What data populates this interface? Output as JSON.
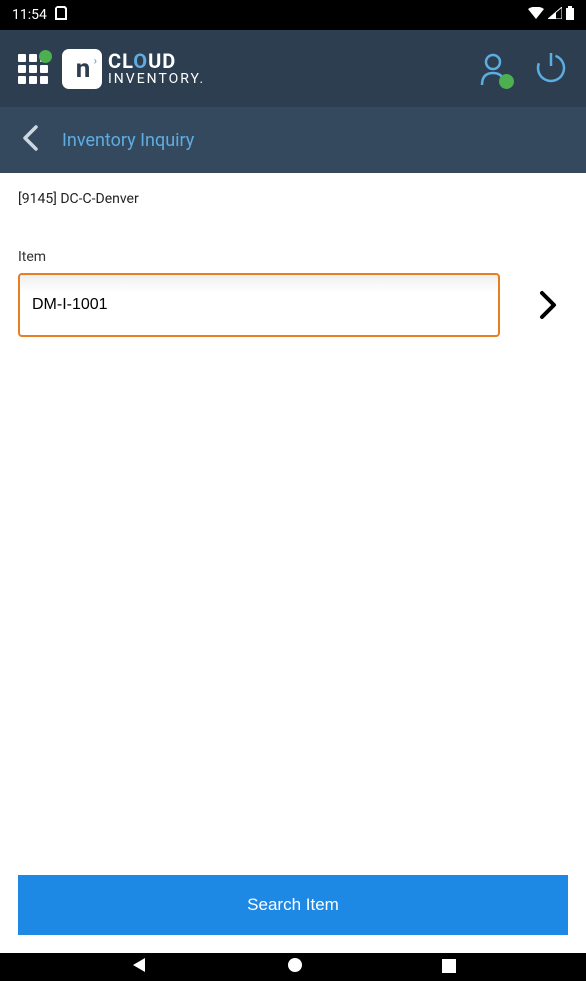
{
  "status": {
    "time": "11:54"
  },
  "header": {
    "logo_top": "CLOUD",
    "logo_bottom": "INVENTORY."
  },
  "subheader": {
    "title": "Inventory Inquiry"
  },
  "content": {
    "location": "[9145] DC-C-Denver",
    "item_label": "Item",
    "item_value": "DM-I-1001"
  },
  "actions": {
    "search_label": "Search Item"
  }
}
